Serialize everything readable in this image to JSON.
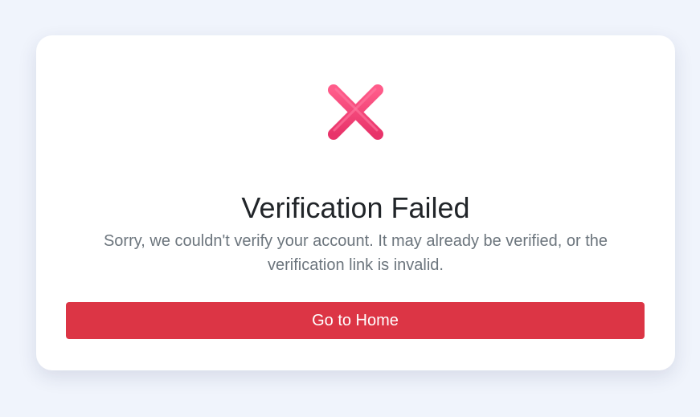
{
  "status": {
    "icon": "cross-mark-icon",
    "title": "Verification Failed",
    "message": "Sorry, we couldn't verify your account. It may already be verified, or the verification link is invalid."
  },
  "actions": {
    "home_label": "Go to Home"
  },
  "colors": {
    "background": "#f0f4fc",
    "card": "#ffffff",
    "icon": "#f5487a",
    "title": "#212529",
    "message": "#6c757d",
    "button": "#dc3545",
    "button_text": "#ffffff"
  }
}
